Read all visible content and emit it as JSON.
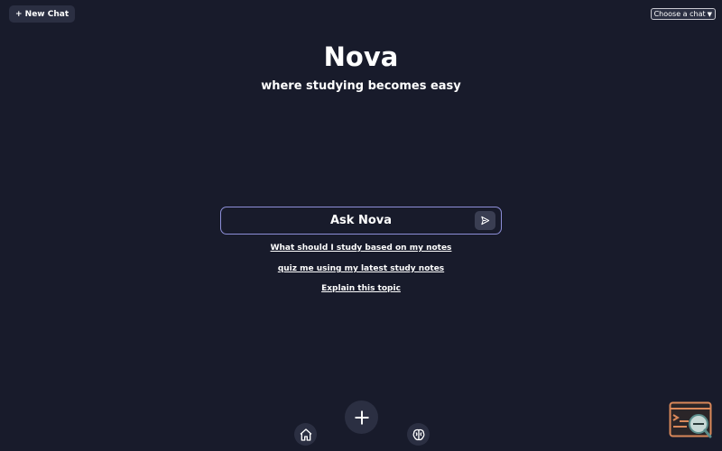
{
  "header": {
    "new_chat_label": "+ New Chat",
    "chat_select_value": "Choose a chat"
  },
  "hero": {
    "title": "Nova",
    "subtitle": "where studying becomes easy"
  },
  "ask": {
    "placeholder": "Ask Nova"
  },
  "suggestions": [
    "What should I study based on my notes",
    "quiz me using my latest study notes",
    "Explain this topic"
  ],
  "icons": {
    "send": "send-icon",
    "home": "home-icon",
    "add": "plus-icon",
    "brain": "brain-icon",
    "search": "code-search-icon"
  },
  "colors": {
    "background": "#181b2b",
    "button": "#2b2f42",
    "accent_border": "#8d8fd8",
    "widget_orange": "#d9885a",
    "widget_teal": "#5a8c8a"
  }
}
